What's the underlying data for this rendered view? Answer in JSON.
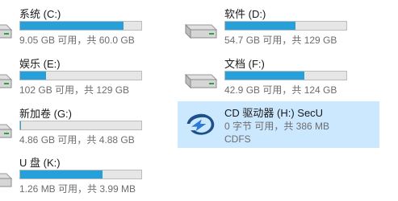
{
  "drives": [
    {
      "name": "系统 (C:)",
      "info": "9.05 GB 可用，共 60.0 GB",
      "used_fraction": 0.85
    },
    {
      "name": "软件 (D:)",
      "info": "54.7 GB 可用，共 129 GB",
      "used_fraction": 0.58
    },
    {
      "name": "娱乐 (E:)",
      "info": "102 GB 可用，共 129 GB",
      "used_fraction": 0.21
    },
    {
      "name": "文档 (F:)",
      "info": "42.9 GB 可用，共 124 GB",
      "used_fraction": 0.65
    },
    {
      "name": "新加卷 (G:)",
      "info": "4.86 GB 可用，共 4.88 GB",
      "used_fraction": 0.005
    },
    {
      "name": "U 盘 (K:)",
      "info": "1.26 MB 可用，共 3.99 MB",
      "used_fraction": 0.68
    }
  ],
  "cd": {
    "name": "CD 驱动器 (H:) SecU",
    "info": "0 字节 可用，共 386 MB",
    "filesystem": "CDFS"
  },
  "colors": {
    "bar_fill": "#26a0da",
    "bar_bg": "#e6e6e6",
    "selected": "#cce8ff"
  }
}
